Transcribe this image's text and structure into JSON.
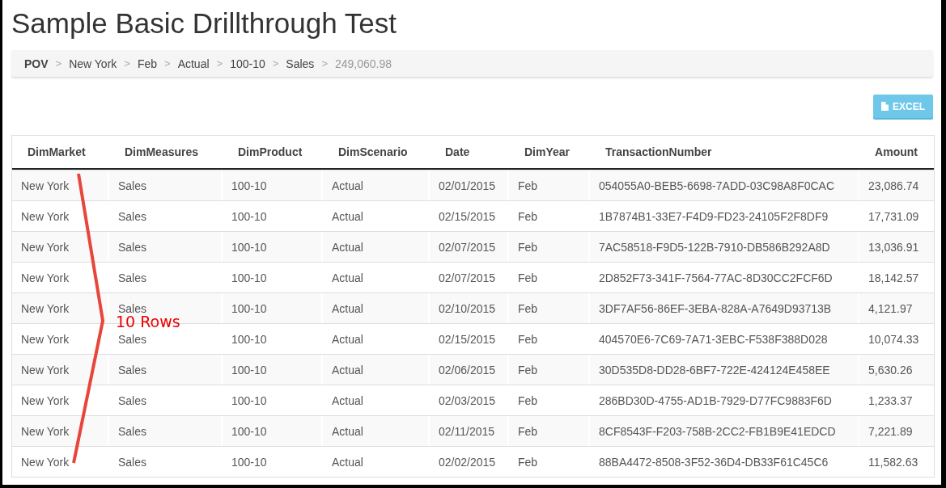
{
  "title": "Sample Basic Drillthrough Test",
  "breadcrumb": [
    {
      "label": "POV",
      "current": false,
      "kind": "root"
    },
    {
      "label": "New York",
      "separator": ">",
      "current": false,
      "kind": "member"
    },
    {
      "label": "Feb",
      "separator": ">",
      "current": false,
      "kind": "member"
    },
    {
      "label": "Actual",
      "separator": ">",
      "current": false,
      "kind": "member"
    },
    {
      "label": "100-10",
      "separator": ">",
      "current": false,
      "kind": "member"
    },
    {
      "label": "Sales",
      "separator": ">",
      "current": false,
      "kind": "member"
    },
    {
      "label": "249,060.98",
      "separator": ">",
      "current": true,
      "kind": "member"
    }
  ],
  "export_button": {
    "label": "EXCEL"
  },
  "table": {
    "columns": [
      "DimMarket",
      "DimMeasures",
      "DimProduct",
      "DimScenario",
      "Date",
      "DimYear",
      "TransactionNumber",
      "Amount"
    ],
    "rows": [
      [
        "New York",
        "Sales",
        "100-10",
        "Actual",
        "02/01/2015",
        "Feb",
        "054055A0-BEB5-6698-7ADD-03C98A8F0CAC",
        "23,086.74"
      ],
      [
        "New York",
        "Sales",
        "100-10",
        "Actual",
        "02/15/2015",
        "Feb",
        "1B7874B1-33E7-F4D9-FD23-24105F2F8DF9",
        "17,731.09"
      ],
      [
        "New York",
        "Sales",
        "100-10",
        "Actual",
        "02/07/2015",
        "Feb",
        "7AC58518-F9D5-122B-7910-DB586B292A8D",
        "13,036.91"
      ],
      [
        "New York",
        "Sales",
        "100-10",
        "Actual",
        "02/07/2015",
        "Feb",
        "2D852F73-341F-7564-77AC-8D30CC2FCF6D",
        "18,142.57"
      ],
      [
        "New York",
        "Sales",
        "100-10",
        "Actual",
        "02/10/2015",
        "Feb",
        "3DF7AF56-86EF-3EBA-828A-A7649D93713B",
        "4,121.97"
      ],
      [
        "New York",
        "Sales",
        "100-10",
        "Actual",
        "02/15/2015",
        "Feb",
        "404570E6-7C69-7A71-3EBC-F538F388D028",
        "10,074.33"
      ],
      [
        "New York",
        "Sales",
        "100-10",
        "Actual",
        "02/06/2015",
        "Feb",
        "30D535D8-DD28-6BF7-722E-424124E458EE",
        "5,630.26"
      ],
      [
        "New York",
        "Sales",
        "100-10",
        "Actual",
        "02/03/2015",
        "Feb",
        "286BD30D-4755-AD1B-7929-D77FC9883F6D",
        "1,233.37"
      ],
      [
        "New York",
        "Sales",
        "100-10",
        "Actual",
        "02/11/2015",
        "Feb",
        "8CF8543F-F203-758B-2CC2-FB1B9E41EDCD",
        "7,221.89"
      ],
      [
        "New York",
        "Sales",
        "100-10",
        "Actual",
        "02/02/2015",
        "Feb",
        "88BA4472-8508-3F52-36D4-DB33F61C45C6",
        "11,582.63"
      ]
    ]
  },
  "annotation": {
    "label": "10 Rows"
  }
}
